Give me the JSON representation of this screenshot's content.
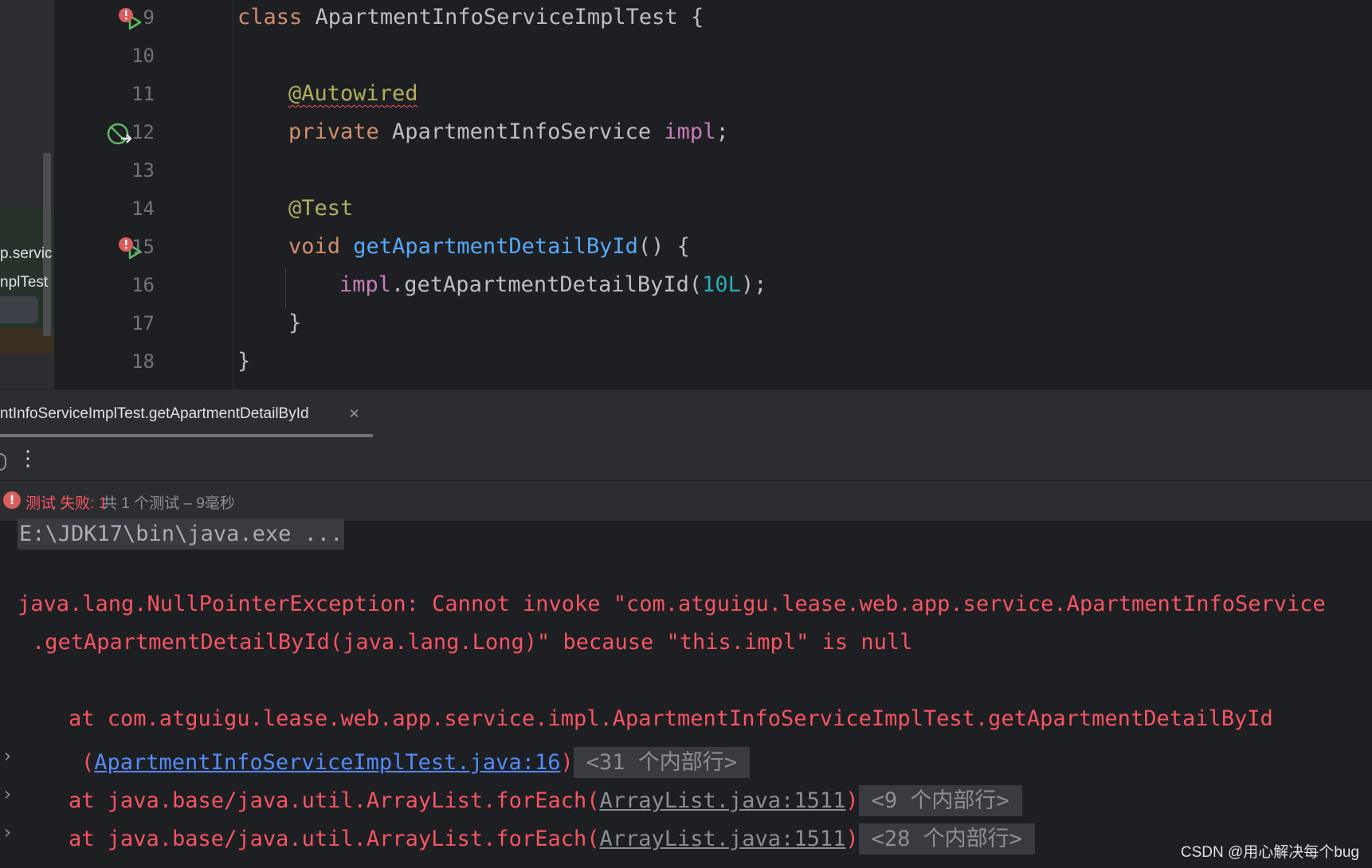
{
  "project_tree": {
    "fragment_1": "p.servic",
    "fragment_2": "nplTest"
  },
  "editor": {
    "line_numbers": [
      "9",
      "10",
      "11",
      "12",
      "13",
      "14",
      "15",
      "16",
      "17",
      "18"
    ],
    "code": {
      "l9_kw": "class",
      "l9_rest": " ApartmentInfoServiceImplTest {",
      "l11_ann": "@Autowired",
      "l12_kw": "private",
      "l12_type": " ApartmentInfoService ",
      "l12_field": "impl",
      "l12_end": ";",
      "l14_ann": "@Test",
      "l15_kw": "void",
      "l15_fn": "getApartmentDetailById",
      "l15_end": "() {",
      "l16_field": "impl",
      "l16_call": ".getApartmentDetailById(",
      "l16_num": "10L",
      "l16_end": ");",
      "l17": "}",
      "l18": "}"
    },
    "gutter_icons": [
      "run-test-failed-icon",
      "injected-bean-icon",
      "run-test-failed-icon"
    ]
  },
  "run_panel": {
    "tab_label": "ntInfoServiceImplTest.getApartmentDetailById",
    "tab_close": "×",
    "more_icon": "⋮",
    "status": {
      "icon": "!",
      "failed_text": "测试 失败: 1",
      "total_text": "共 1 个测试 – 9毫秒"
    },
    "console": {
      "command": "E:\\JDK17\\bin\\java.exe ...",
      "exception_line1": "java.lang.NullPointerException: Cannot invoke \"com.atguigu.lease.web.app.service.ApartmentInfoService",
      "exception_line2": ".getApartmentDetailById(java.lang.Long)\" because \"this.impl\" is null",
      "at1_line1": "at com.atguigu.lease.web.app.service.impl.ApartmentInfoServiceImplTest.getApartmentDetailById",
      "at1_open": "(",
      "at1_link": "ApartmentInfoServiceImplTest.java:16",
      "at1_close": ")",
      "at1_fold": "<31 个内部行>",
      "at2_prefix": "at java.base/java.util.ArrayList.forEach(",
      "at2_link": "ArrayList.java:1511",
      "at2_close": ")",
      "at2_fold": "<9 个内部行>",
      "at3_prefix": "at java.base/java.util.ArrayList.forEach(",
      "at3_link": "ArrayList.java:1511",
      "at3_close": ")",
      "at3_fold": "<28 个内部行>",
      "chevron": "›"
    }
  },
  "watermark": "CSDN @用心解决每个bug",
  "colors": {
    "background": "#1e1f22",
    "panel": "#2b2d30",
    "error": "#f75464",
    "keyword": "#cf8e6d",
    "annotation": "#b3ae60",
    "field": "#c77dbb",
    "function": "#56a8f5",
    "number": "#2aacb8",
    "link": "#548af7"
  }
}
